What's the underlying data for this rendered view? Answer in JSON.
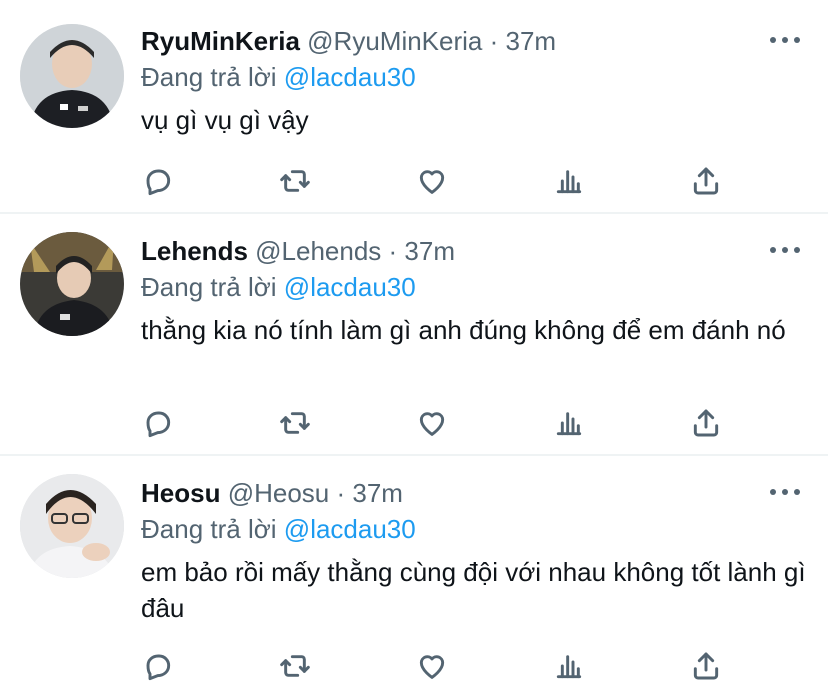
{
  "tweets": [
    {
      "name": "RyuMinKeria",
      "handle": "@RyuMinKeria",
      "time": "· 37m",
      "reply_prefix": "Đang trả lời",
      "reply_to": "@lacdau30",
      "text": "vụ gì vụ gì vậy"
    },
    {
      "name": "Lehends",
      "handle": "@Lehends",
      "time": "· 37m",
      "reply_prefix": "Đang trả lời",
      "reply_to": "@lacdau30",
      "text": "thằng kia nó tính làm gì anh đúng không để em đánh nó"
    },
    {
      "name": "Heosu",
      "handle": "@Heosu",
      "time": "· 37m",
      "reply_prefix": "Đang trả lời",
      "reply_to": "@lacdau30",
      "text": "em bảo rồi mấy thằng cùng đội với nhau không tốt lành gì đâu"
    }
  ],
  "icons": {
    "reply": "comment-icon",
    "retweet": "retweet-icon",
    "like": "heart-icon",
    "analytics": "analytics-icon",
    "share": "share-icon",
    "more": "more-options-icon"
  },
  "colors": {
    "mention": "#1d9bf0",
    "secondary_text": "#536471",
    "divider": "#eff3f4"
  }
}
